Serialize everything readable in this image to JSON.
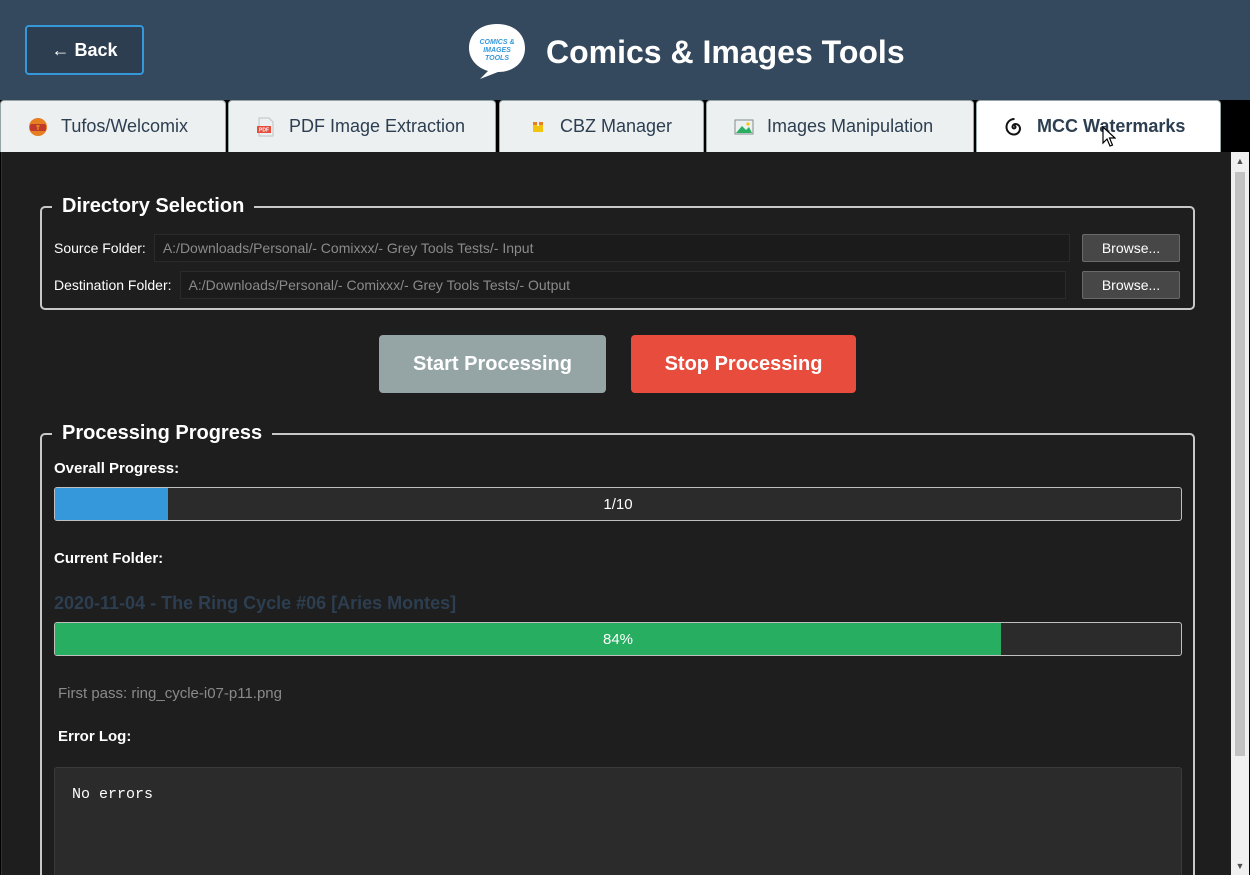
{
  "header": {
    "back_label": "← Back",
    "title": "Comics & Images Tools",
    "logo_text": [
      "COMICS &",
      "IMAGES",
      "TOOLS"
    ]
  },
  "tabs": [
    {
      "label": "Tufos/Welcomix",
      "icon": "tufos-icon",
      "active": false
    },
    {
      "label": "PDF Image Extraction",
      "icon": "pdf-icon",
      "active": false
    },
    {
      "label": "CBZ Manager",
      "icon": "cbz-archive-icon",
      "active": false
    },
    {
      "label": "Images Manipulation",
      "icon": "image-icon",
      "active": false
    },
    {
      "label": "MCC Watermarks",
      "icon": "spiral-icon",
      "active": true
    }
  ],
  "directory_selection": {
    "legend": "Directory Selection",
    "source_label": "Source Folder:",
    "source_value": "A:/Downloads/Personal/- Comixxx/- Grey Tools Tests/- Input",
    "destination_label": "Destination Folder:",
    "destination_value": "A:/Downloads/Personal/- Comixxx/- Grey Tools Tests/- Output",
    "browse_label": "Browse..."
  },
  "actions": {
    "start_label": "Start Processing",
    "stop_label": "Stop Processing"
  },
  "progress": {
    "legend": "Processing Progress",
    "overall_label": "Overall Progress:",
    "overall_text": "1/10",
    "overall_fraction": 0.1,
    "current_folder_label": "Current Folder:",
    "current_folder_name": "2020-11-04 - The Ring Cycle #06 [Aries Montes]",
    "folder_text": "84%",
    "folder_fraction": 0.84,
    "status_text": "First pass: ring_cycle-i07-p11.png",
    "error_log_label": "Error Log:",
    "error_log_text": "No errors"
  },
  "colors": {
    "header_bg": "#34495e",
    "accent_blue": "#3498db",
    "start_button": "#95a5a6",
    "stop_button": "#e74c3c",
    "folder_progress": "#27ae60"
  }
}
